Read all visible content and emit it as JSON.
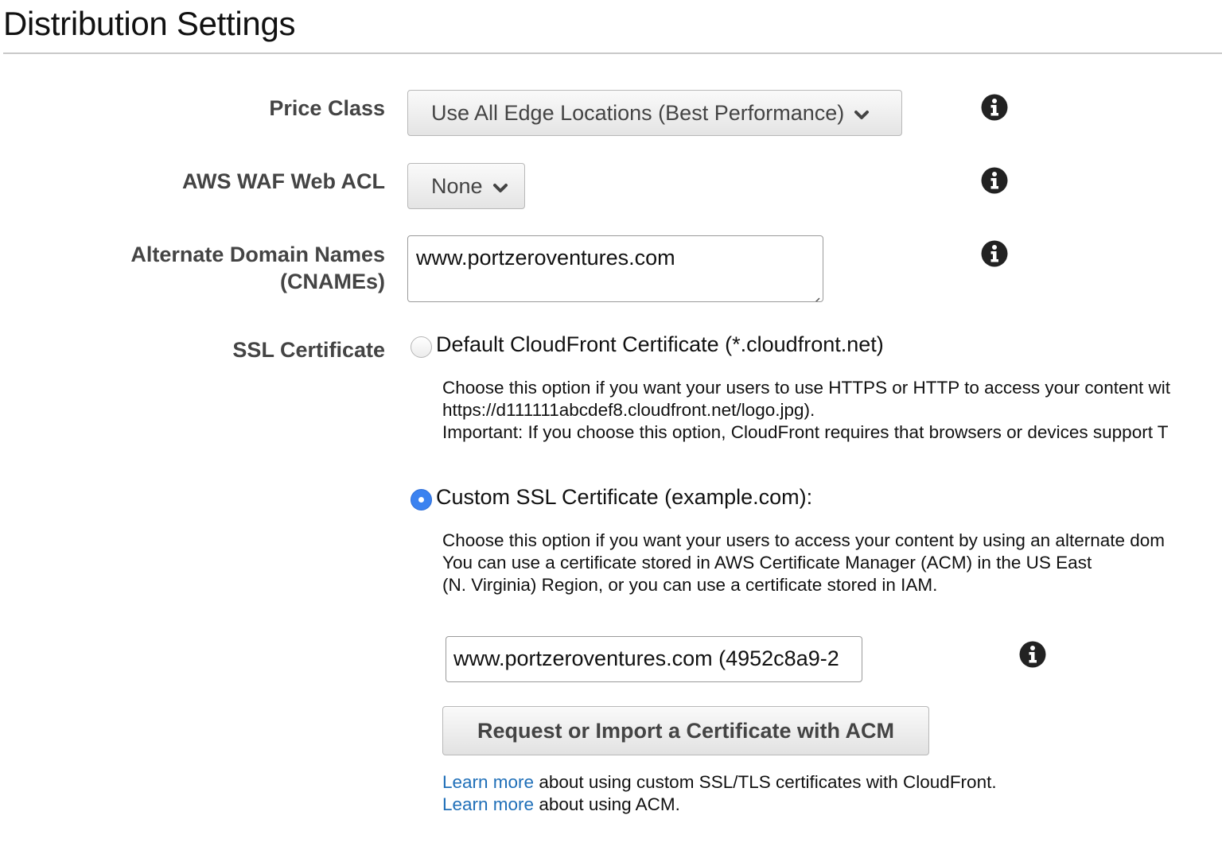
{
  "page": {
    "title": "Distribution Settings"
  },
  "price_class": {
    "label": "Price Class",
    "value": "Use All Edge Locations (Best Performance)"
  },
  "waf": {
    "label": "AWS WAF Web ACL",
    "value": "None"
  },
  "cnames": {
    "label_line1": "Alternate Domain Names",
    "label_line2": "(CNAMEs)",
    "value": "www.portzeroventures.com"
  },
  "ssl": {
    "label": "SSL Certificate",
    "default_option": {
      "label": "Default CloudFront Certificate (*.cloudfront.net)",
      "selected": false,
      "desc": [
        "Choose this option if you want your users to use HTTPS or HTTP to access your content wit",
        "https://d111111abcdef8.cloudfront.net/logo.jpg).",
        "Important: If you choose this option, CloudFront requires that browsers or devices support T"
      ]
    },
    "custom_option": {
      "label": "Custom SSL Certificate (example.com):",
      "selected": true,
      "desc": [
        "Choose this option if you want your users to access your content by using an alternate dom",
        "You can use a certificate stored in AWS Certificate Manager (ACM) in the US East",
        "(N. Virginia) Region, or you can use a certificate stored in IAM."
      ],
      "certificate_value": "www.portzeroventures.com (4952c8a9-2",
      "acm_button": "Request or Import a Certificate with ACM",
      "learn_more_1": {
        "link": "Learn more",
        "text": " about using custom SSL/TLS certificates with CloudFront."
      },
      "learn_more_2": {
        "link": "Learn more",
        "text": " about using ACM."
      }
    }
  },
  "icons": [
    "info-icon",
    "chevron-down-icon",
    "resize-grip-icon"
  ],
  "colors": {
    "link": "#1f6fb8",
    "radio_selected": "#3b82f0"
  }
}
